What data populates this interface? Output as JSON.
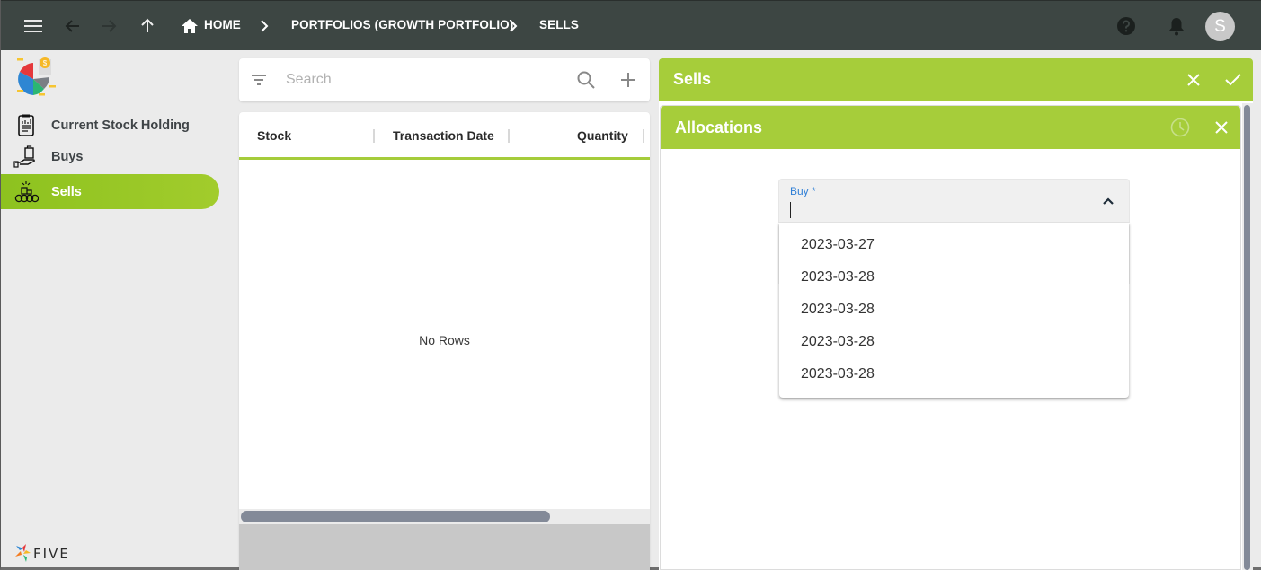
{
  "topbar": {
    "breadcrumbs": [
      {
        "label": "HOME",
        "icon": "home-icon"
      },
      {
        "label": "PORTFOLIOS (GROWTH PORTFOLIO)"
      },
      {
        "label": "SELLS"
      }
    ],
    "avatar_initial": "S"
  },
  "sidebar": {
    "items": [
      {
        "label": "Current Stock Holding",
        "icon": "report-clipboard-icon",
        "active": false
      },
      {
        "label": "Buys",
        "icon": "hand-bag-icon",
        "active": false
      },
      {
        "label": "Sells",
        "icon": "coins-sell-icon",
        "active": true
      }
    ],
    "brand": "FIVE"
  },
  "search": {
    "placeholder": "Search",
    "value": ""
  },
  "grid": {
    "columns": [
      "Stock",
      "Transaction Date",
      "Quantity"
    ],
    "rows": [],
    "empty_message": "No Rows"
  },
  "sells_panel": {
    "title": "Sells"
  },
  "allocations_panel": {
    "title": "Allocations",
    "buy_field": {
      "label": "Buy *",
      "value": "",
      "options": [
        "2023-03-27",
        "2023-03-28",
        "2023-03-28",
        "2023-03-28",
        "2023-03-28"
      ]
    }
  },
  "colors": {
    "accent": "#a6cd3a",
    "topbar": "#3d4643",
    "field_label": "#2f7fd6"
  }
}
